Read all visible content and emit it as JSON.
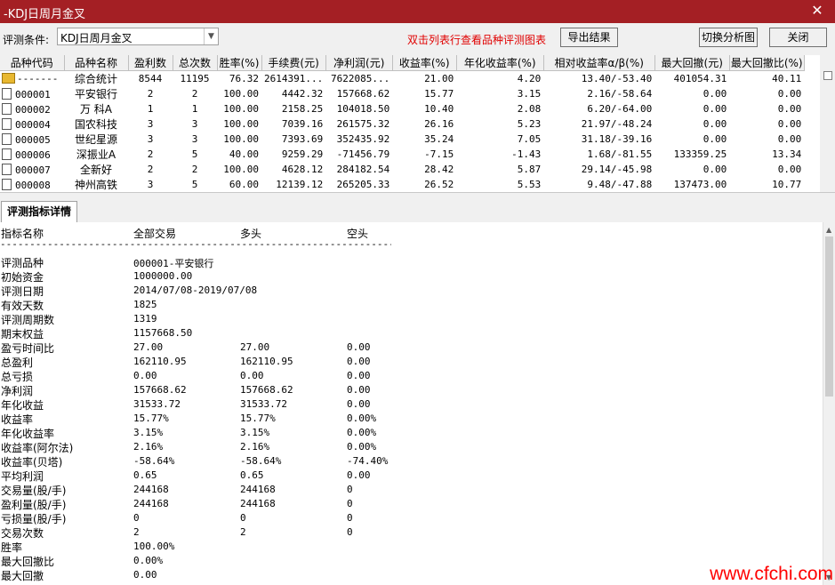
{
  "window": {
    "title": "-KDJ日周月金叉",
    "close_glyph": "✕"
  },
  "toolbar": {
    "cond_label": "评测条件:",
    "cond_value": "KDJ日周月金叉",
    "hint": "双击列表行查看品种评测图表",
    "export_label": "导出结果",
    "switch_label": "切换分析图",
    "close_label": "关闭"
  },
  "table": {
    "headers": [
      "品种代码",
      "品种名称",
      "盈利数",
      "总次数",
      "胜率(%)",
      "手续费(元)",
      "净利润(元)",
      "收益率(%)",
      "年化收益率(%)",
      "相对收益率α/β(%)",
      "最大回撤(元)",
      "最大回撤比(%)"
    ],
    "rows": [
      [
        "-------",
        "综合统计",
        "8544",
        "11195",
        "76.32",
        "2614391...",
        "7622085...",
        "21.00",
        "4.20",
        "13.40/-53.40",
        "401054.31",
        "40.11"
      ],
      [
        "000001",
        "平安银行",
        "2",
        "2",
        "100.00",
        "4442.32",
        "157668.62",
        "15.77",
        "3.15",
        "2.16/-58.64",
        "0.00",
        "0.00"
      ],
      [
        "000002",
        "万 科A",
        "1",
        "1",
        "100.00",
        "2158.25",
        "104018.50",
        "10.40",
        "2.08",
        "6.20/-64.00",
        "0.00",
        "0.00"
      ],
      [
        "000004",
        "国农科技",
        "3",
        "3",
        "100.00",
        "7039.16",
        "261575.32",
        "26.16",
        "5.23",
        "21.97/-48.24",
        "0.00",
        "0.00"
      ],
      [
        "000005",
        "世纪星源",
        "3",
        "3",
        "100.00",
        "7393.69",
        "352435.92",
        "35.24",
        "7.05",
        "31.18/-39.16",
        "0.00",
        "0.00"
      ],
      [
        "000006",
        "深振业A",
        "2",
        "5",
        "40.00",
        "9259.29",
        "-71456.79",
        "-7.15",
        "-1.43",
        "1.68/-81.55",
        "133359.25",
        "13.34"
      ],
      [
        "000007",
        "全新好",
        "2",
        "2",
        "100.00",
        "4628.12",
        "284182.54",
        "28.42",
        "5.87",
        "29.14/-45.98",
        "0.00",
        "0.00"
      ],
      [
        "000008",
        "神州高铁",
        "3",
        "5",
        "60.00",
        "12139.12",
        "265205.33",
        "26.52",
        "5.53",
        "9.48/-47.88",
        "137473.00",
        "10.77"
      ]
    ]
  },
  "tab_label": "评测指标详情",
  "detail": {
    "headers": [
      "指标名称",
      "全部交易",
      "多头",
      "空头"
    ],
    "dashes": "------------------------------------------------------------------------------",
    "rows": [
      [
        "评测品种",
        "000001-平安银行",
        "",
        ""
      ],
      [
        "初始资金",
        "1000000.00",
        "",
        ""
      ],
      [
        "评测日期",
        "2014/07/08-2019/07/08",
        "",
        ""
      ],
      [
        "有效天数",
        "1825",
        "",
        ""
      ],
      [
        "评测周期数",
        "1319",
        "",
        ""
      ],
      [
        "期末权益",
        "1157668.50",
        "",
        ""
      ],
      [
        "盈亏时间比",
        "27.00",
        "27.00",
        "0.00"
      ],
      [
        "总盈利",
        "162110.95",
        "162110.95",
        "0.00"
      ],
      [
        "总亏损",
        "0.00",
        "0.00",
        "0.00"
      ],
      [
        "净利润",
        "157668.62",
        "157668.62",
        "0.00"
      ],
      [
        "年化收益",
        "31533.72",
        "31533.72",
        "0.00"
      ],
      [
        "收益率",
        "15.77%",
        "15.77%",
        "0.00%"
      ],
      [
        "年化收益率",
        "3.15%",
        "3.15%",
        "0.00%"
      ],
      [
        "收益率(阿尔法)",
        "2.16%",
        "2.16%",
        "0.00%"
      ],
      [
        "收益率(贝塔)",
        "-58.64%",
        "-58.64%",
        "-74.40%"
      ],
      [
        "平均利润",
        "0.65",
        "0.65",
        "0.00"
      ],
      [
        "交易量(股/手)",
        "244168",
        "244168",
        "0"
      ],
      [
        "盈利量(股/手)",
        "244168",
        "244168",
        "0"
      ],
      [
        "亏损量(股/手)",
        "0",
        "0",
        "0"
      ],
      [
        "交易次数",
        "2",
        "2",
        "0"
      ],
      [
        "胜率",
        "100.00%",
        "",
        ""
      ],
      [
        "最大回撤比",
        "0.00%",
        "",
        ""
      ],
      [
        "最大回撤",
        "0.00",
        "",
        ""
      ]
    ]
  },
  "watermark": "www.cfchi.com",
  "colors": {
    "titlebar": "#a41f24",
    "hint": "#e00000",
    "watermark": "#ff0000"
  },
  "icons": {
    "row_doc": "document-icon",
    "summary_row": "folder-icon"
  }
}
